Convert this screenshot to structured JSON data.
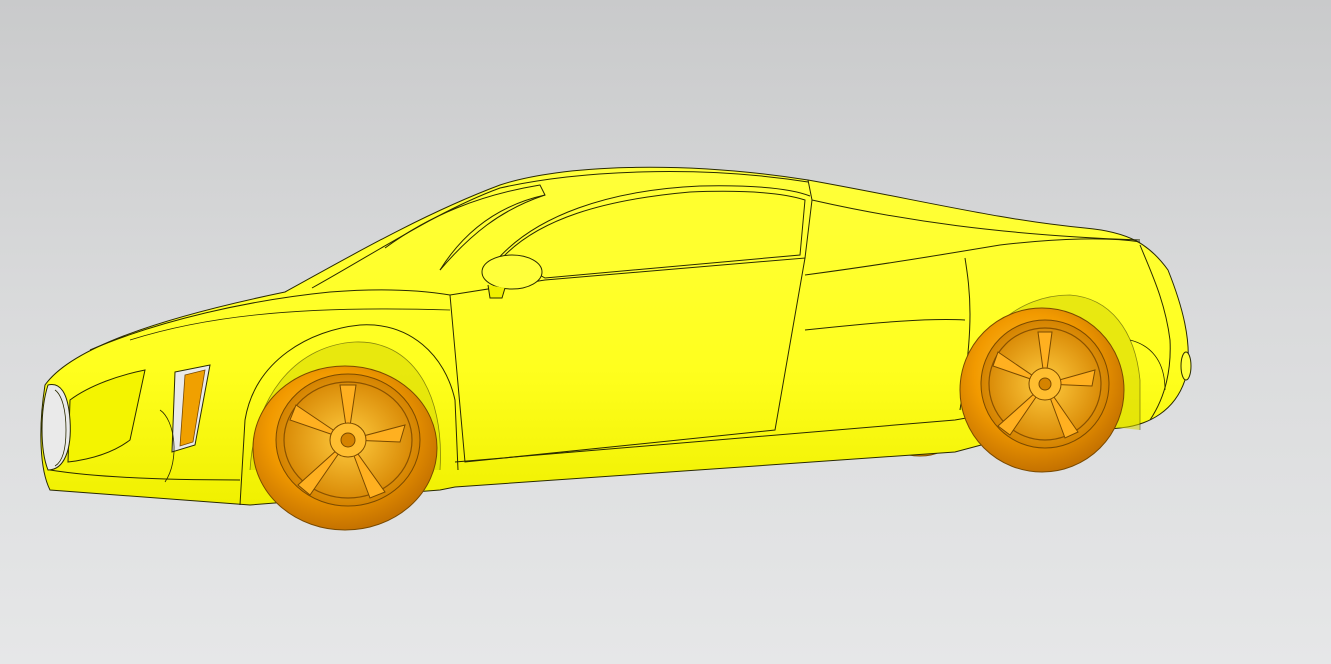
{
  "scene": {
    "model_name": "",
    "colors": {
      "background_top": "#c9cacb",
      "background_bottom": "#e6e7e8",
      "body": "#ffff26",
      "body_shade": "#e8e800",
      "edge": "#2a2a00",
      "wheel": "#f2a000",
      "wheel_highlight": "#ffc83a",
      "wheel_shadow": "#b86c00"
    }
  }
}
